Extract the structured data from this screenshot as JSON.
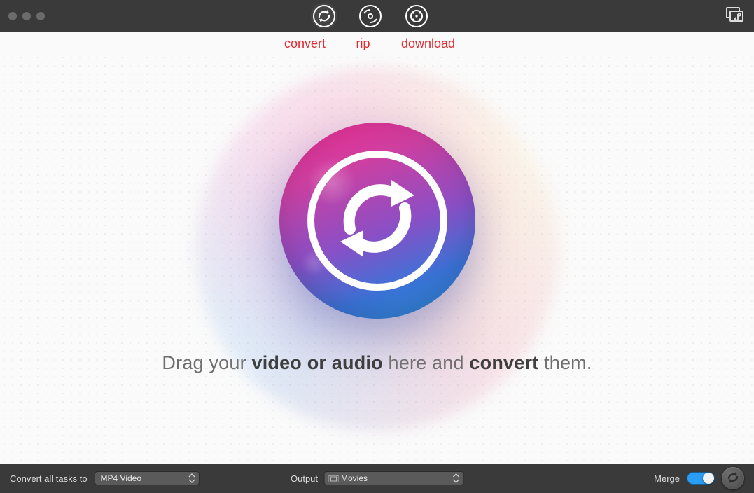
{
  "toolbar": {
    "tabs": [
      {
        "id": "convert",
        "label": "convert"
      },
      {
        "id": "rip",
        "label": "rip"
      },
      {
        "id": "download",
        "label": "download"
      }
    ],
    "active_tab": "convert"
  },
  "main": {
    "prompt_prefix": "Drag your ",
    "prompt_bold1": "video or audio",
    "prompt_mid": " here and ",
    "prompt_bold2": "convert",
    "prompt_suffix": " them."
  },
  "bottombar": {
    "convert_label": "Convert all tasks to",
    "format_value": "MP4 Video",
    "output_label": "Output",
    "output_value": "Movies",
    "merge_label": "Merge",
    "merge_on": true
  },
  "icons": {
    "convert": "convert-icon",
    "rip": "rip-icon",
    "download": "download-icon",
    "playlist": "add-to-list-icon",
    "folder": "folder-icon",
    "go": "start-convert-icon"
  },
  "colors": {
    "accent_red": "#e3282e",
    "toggle_on": "#2a9df4"
  }
}
